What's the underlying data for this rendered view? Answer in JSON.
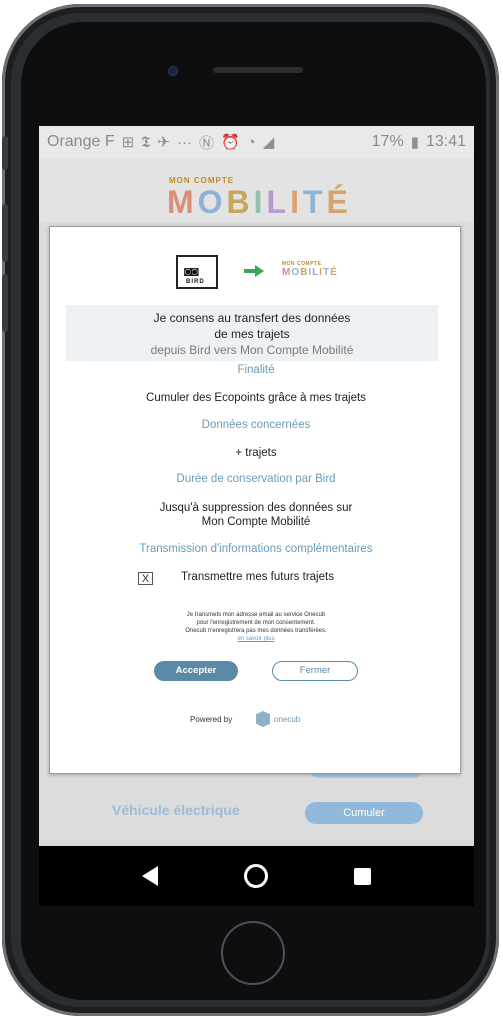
{
  "status_bar": {
    "carrier": "Orange F",
    "icons": [
      "app-icon",
      "newspaper-icon",
      "bird-icon",
      "more-icon",
      "nfc-icon",
      "alarm-icon",
      "wifi-icon",
      "signal-icon"
    ],
    "more": "···",
    "battery": "17%",
    "time": "13:41"
  },
  "app_header": {
    "brand_small": "MON COMPTE",
    "brand_big": [
      "M",
      "O",
      "B",
      "I",
      "L",
      "I",
      "T",
      "É"
    ]
  },
  "dialog": {
    "logos": {
      "bird_text": "BIRD",
      "bird_glasses": "◙◙",
      "mcm_small": "MON COMPTE",
      "mcm_big": [
        "M",
        "O",
        "B",
        "I",
        "L",
        "I",
        "T",
        "É"
      ]
    },
    "consent": {
      "line1": "Je consens au transfert des données",
      "line2": "de mes trajets",
      "line3": "depuis Bird vers Mon Compte Mobilité"
    },
    "finalite_label": "Finalité",
    "finalite_value": "Cumuler des Ecopoints grâce à mes trajets",
    "donnees_label": "Données concernées",
    "donnees_value": "+ trajets",
    "duree_label": "Durée de conservation par Bird",
    "duree_value_1": "Jusqu'à suppression des données sur",
    "duree_value_2": "Mon Compte Mobilité",
    "transmission_label": "Transmission d'informations complémentaires",
    "checkbox_mark": "X",
    "checkbox_label": "Transmettre mes futurs trajets",
    "fine_print_1": "Je transmets mon adresse email au service Onecub",
    "fine_print_2": "pour l'enregistrement de mon consentement.",
    "fine_print_3": "Onecub n'enregistrera pas mes données transférées.",
    "fine_print_link": "en savoir plus",
    "accept_label": "Accepter",
    "close_label": "Fermer",
    "powered_by": "Powered by",
    "onecub": "onecub"
  },
  "background": {
    "vehicule_label": "Véhicule électrique",
    "cumuler_label": "Cumuler"
  },
  "nav_bar": {
    "icons": [
      "back-icon",
      "home-icon",
      "recent-apps-icon"
    ]
  },
  "colors": {
    "accent": "#5b8aa7",
    "label_blue": "#6a9ab8",
    "consent_bg": "#eef1f3"
  }
}
